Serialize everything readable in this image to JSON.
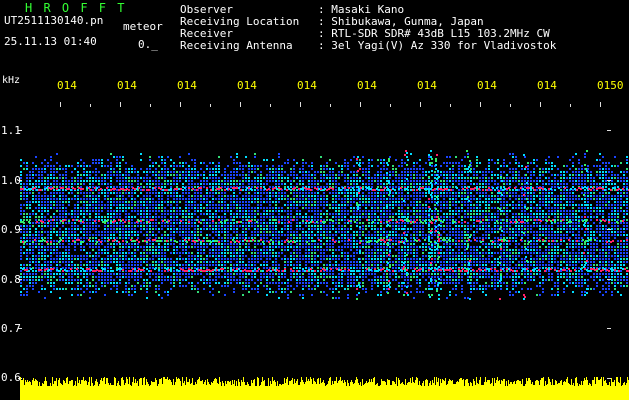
{
  "header": {
    "logo": "H R O F F T",
    "filename": "UT2511130140.pn",
    "meteor_label": "meteor",
    "datetime": "25.11.13 01:40",
    "counter": "0._"
  },
  "info": [
    {
      "label": "Observer",
      "value": ": Masaki Kano"
    },
    {
      "label": "Receiving Location",
      "value": ": Shibukawa, Gunma, Japan"
    },
    {
      "label": "Receiver",
      "value": ": RTL-SDR SDR# 43dB L15 103.2MHz CW"
    },
    {
      "label": "Receiving Antenna",
      "value": ": 3el Yagi(V) Az 330 for Vladivostok"
    }
  ],
  "axis": {
    "y_unit": "kHz",
    "y_ticks": [
      "1.1",
      "1.0",
      "0.9",
      "0.8",
      "0.7",
      "0.6"
    ],
    "x_ticks": [
      "014",
      "014",
      "014",
      "014",
      "014",
      "014",
      "014",
      "014",
      "014",
      "0150"
    ]
  },
  "colors": {
    "text_white": "#ffffff",
    "text_yellow": "#ffff00",
    "logo_green": "#33ff33",
    "tick": "#dddddd",
    "signal_pink": "#ff2266",
    "noise_blue": "#1a44ff",
    "noise_cyan": "#00ddff",
    "bar_yellow": "#ffff00",
    "background": "#000000"
  }
}
